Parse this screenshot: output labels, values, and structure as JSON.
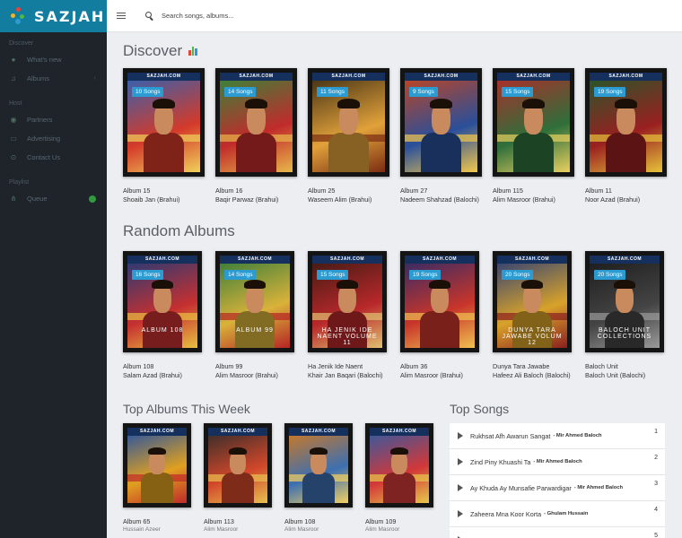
{
  "brand": {
    "name": "SAZJAH"
  },
  "search": {
    "placeholder": "Search songs, albums..."
  },
  "sidebar": {
    "sections": [
      {
        "title": "Discover",
        "items": [
          {
            "label": "What's new",
            "icon": "whatsapp-icon"
          },
          {
            "label": "Albums",
            "icon": "music-note-icon",
            "chevron": "‹"
          }
        ]
      },
      {
        "title": "Host",
        "items": [
          {
            "label": "Partners",
            "icon": "partners-icon"
          },
          {
            "label": "Advertising",
            "icon": "advertising-icon"
          },
          {
            "label": "Contact Us",
            "icon": "contact-icon"
          }
        ]
      },
      {
        "title": "Playlist",
        "items": [
          {
            "label": "Queue",
            "icon": "queue-icon",
            "badge": true
          }
        ]
      }
    ]
  },
  "discover": {
    "title": "Discover",
    "albums": [
      {
        "album": "Album 15",
        "artist": "Shoaib Jan (Brahui)",
        "songs": "10 Songs",
        "site": "SAZJAH.COM"
      },
      {
        "album": "Album 16",
        "artist": "Baqir Parwaz (Brahui)",
        "songs": "14 Songs",
        "site": "SAZJAH.COM"
      },
      {
        "album": "Album 25",
        "artist": "Waseem Alim (Brahui)",
        "songs": "11 Songs",
        "site": "SAZJAH.COM"
      },
      {
        "album": "Album 27",
        "artist": "Nadeem Shahzad (Balochi)",
        "songs": "9 Songs",
        "site": "SAZJAH.COM"
      },
      {
        "album": "Album 115",
        "artist": "Alim Masroor (Brahui)",
        "songs": "15 Songs",
        "site": "SAZJAH.COM"
      },
      {
        "album": "Album 11",
        "artist": "Noor Azad (Brahui)",
        "songs": "19 Songs",
        "site": "SAZJAH.COM"
      }
    ]
  },
  "random": {
    "title": "Random Albums",
    "albums": [
      {
        "album": "Album 108",
        "artist": "Salam Azad (Brahui)",
        "songs": "16 Songs",
        "site": "SAZJAH.COM",
        "caption": "ALBUM 108"
      },
      {
        "album": "Album 99",
        "artist": "Alim Masroor (Brahui)",
        "songs": "14 Songs",
        "site": "SAZJAH.COM",
        "caption": "ALBUM 99"
      },
      {
        "album": "Ha Jenik Ide Naent",
        "artist": "Khair Jan Baqari (Balochi)",
        "songs": "15 Songs",
        "site": "SAZJAH.COM",
        "caption": "HA JENIK IDE NAENT VOLUME 11"
      },
      {
        "album": "Album 36",
        "artist": "Alim Masroor (Brahui)",
        "songs": "19 Songs",
        "site": "SAZJAH.COM",
        "caption": ""
      },
      {
        "album": "Dunya Tara Jawabe",
        "artist": "Hafeez Ali Baloch (Balochi)",
        "songs": "20 Songs",
        "site": "SAZJAH.COM",
        "caption": "DUNYA TARA JAWABE VOLUM 12"
      },
      {
        "album": "Baloch Unit",
        "artist": "Baloch Unit (Balochi)",
        "songs": "20 Songs",
        "site": "SAZJAH.COM",
        "caption": "BALOCH UNIT COLLECTIONS"
      }
    ]
  },
  "top_albums": {
    "title": "Top Albums This Week",
    "albums": [
      {
        "album": "Album 65",
        "artist": "Hussain Azeer",
        "site": "SAZJAH.COM"
      },
      {
        "album": "Album 113",
        "artist": "Alim Masroor",
        "site": "SAZJAH.COM"
      },
      {
        "album": "Album 108",
        "artist": "Alim Masroor",
        "site": "SAZJAH.COM"
      },
      {
        "album": "Album 109",
        "artist": "Alim Masroor",
        "site": "SAZJAH.COM"
      }
    ]
  },
  "top_songs": {
    "title": "Top Songs",
    "songs": [
      {
        "title": "Rukhsat Afh Awarun Sangat",
        "artist": "- Mir Ahmed Baloch",
        "rank": "1"
      },
      {
        "title": "Zind Piny Khuashi Ta",
        "artist": "- Mir Ahmed Baloch",
        "rank": "2"
      },
      {
        "title": "Ay Khuda Ay Munsafie Parwardigar",
        "artist": "- Mir Ahmed Baloch",
        "rank": "3"
      },
      {
        "title": "Zaheera Mna Koor Korta",
        "artist": "- Ghulam Hussain",
        "rank": "4"
      },
      {
        "title": "",
        "artist": "",
        "rank": "5"
      }
    ]
  },
  "colors": {
    "brand": "#127d9e",
    "sidebar": "#1e242a",
    "badge": "#2b9bd1",
    "queue_badge": "#2f9b3d"
  }
}
